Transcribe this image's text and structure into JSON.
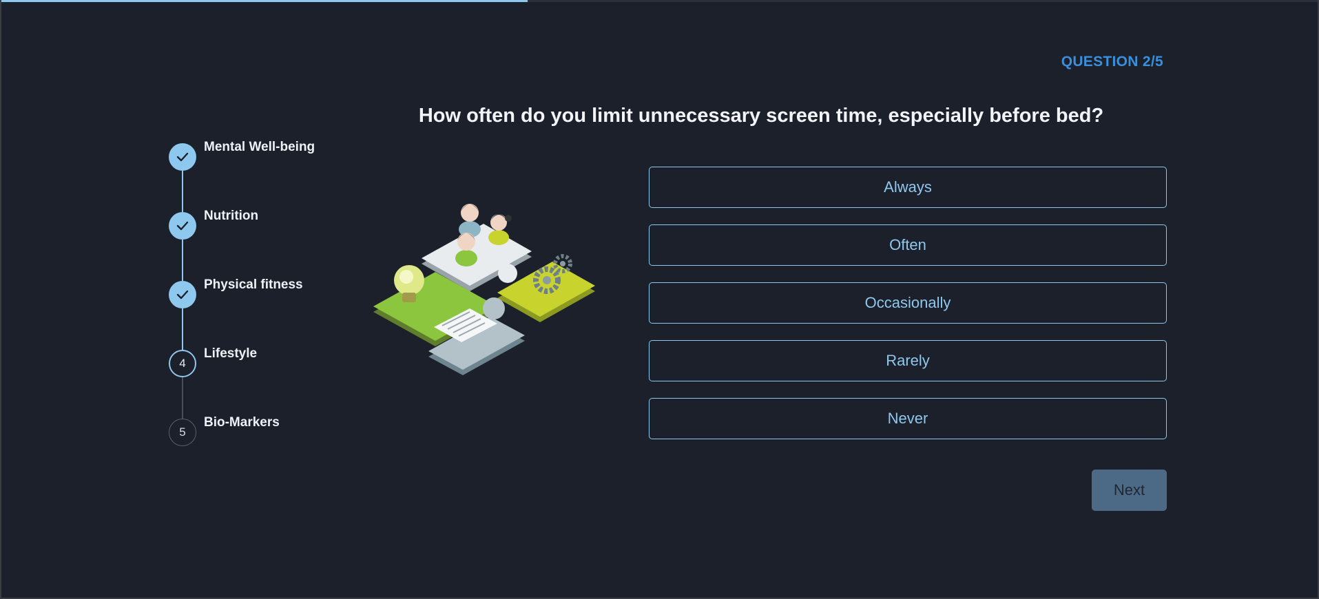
{
  "progress": {
    "fraction": 0.4
  },
  "header": {
    "counter": "QUESTION 2/5"
  },
  "question": {
    "text": "How often do you limit unnecessary screen time, especially before bed?"
  },
  "steps": [
    {
      "label": "Mental Well-being",
      "state": "done",
      "number": "1"
    },
    {
      "label": "Nutrition",
      "state": "done",
      "number": "2"
    },
    {
      "label": "Physical fitness",
      "state": "done",
      "number": "3"
    },
    {
      "label": "Lifestyle",
      "state": "current",
      "number": "4"
    },
    {
      "label": "Bio-Markers",
      "state": "future",
      "number": "5"
    }
  ],
  "options": [
    "Always",
    "Often",
    "Occasionally",
    "Rarely",
    "Never"
  ],
  "actions": {
    "next_label": "Next"
  },
  "colors": {
    "accent": "#8fc8ee",
    "counter": "#3a8fdc",
    "background": "#1b202b",
    "next_button": "#4c6a85"
  },
  "illustration": {
    "icon": "puzzle-teamwork-illustration"
  }
}
